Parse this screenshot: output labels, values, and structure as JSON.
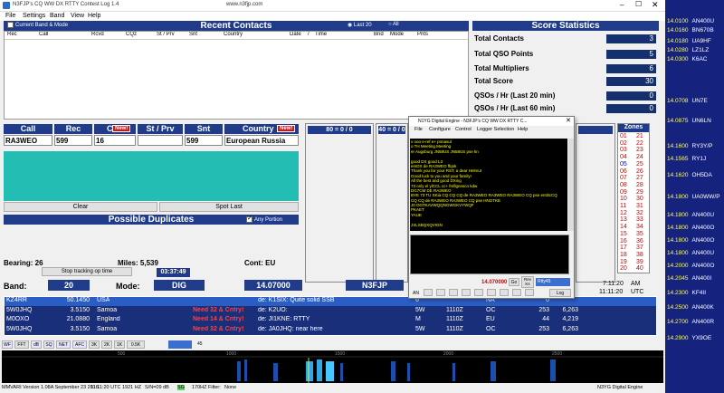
{
  "window": {
    "title": "N3FJP's CQ WW DX RTTY Contest Log 1.4",
    "url": "www.n3fjp.com"
  },
  "menu": [
    "File",
    "Settings",
    "Band",
    "View",
    "Help"
  ],
  "recent": {
    "title": "Recent Contacts",
    "checkbox": "Current Band & Mode",
    "radio1": "Last 20",
    "radio2": "All",
    "headers": [
      "Rec",
      "Call",
      "Rcvd",
      "CQz",
      "St / Prv",
      "Snt",
      "Country",
      "Date",
      "/",
      "Time",
      "Bnd",
      "Mode",
      "Pnts"
    ]
  },
  "score": {
    "title": "Score Statistics",
    "rows": [
      {
        "label": "Total Contacts",
        "value": "3"
      },
      {
        "label": "Total QSO Points",
        "value": "5"
      },
      {
        "label": "Total Multipliers",
        "value": "6"
      },
      {
        "label": "Total Score",
        "value": "30"
      },
      {
        "label": "QSOs / Hr (Last 20 min)",
        "value": "0"
      },
      {
        "label": "QSOs / Hr (Last 60 min)",
        "value": "0"
      }
    ]
  },
  "entry": {
    "call_label": "Call",
    "rec_label": "Rec",
    "cq_label": "C",
    "new_badge": "New!",
    "stprv_label": "St / Prv",
    "snt_label": "Snt",
    "country_label": "Country",
    "call_value": "RA3WEO",
    "rec_value": "599",
    "cq_value": "16",
    "snt_value": "599",
    "country_value": "European Russia"
  },
  "band_boxes": [
    "80 = 0 / 0",
    "40 = 0 / 0"
  ],
  "zones": {
    "title": "Zones",
    "col1": [
      "01",
      "02",
      "03",
      "04",
      "05",
      "06",
      "07",
      "08",
      "09",
      "10",
      "11",
      "12",
      "13",
      "14",
      "15",
      "16",
      "17",
      "18",
      "19",
      "20"
    ],
    "col2": [
      "21",
      "22",
      "23",
      "24",
      "25",
      "26",
      "27",
      "28",
      "29",
      "30",
      "31",
      "32",
      "33",
      "34",
      "35",
      "36",
      "37",
      "38",
      "39",
      "40"
    ]
  },
  "buttons": {
    "clear": "Clear",
    "spot_last": "Spot Last"
  },
  "dupes": {
    "title": "Possible Duplicates",
    "any_portion": "Any Portion"
  },
  "info": {
    "bearing": "Bearing: 26",
    "miles": "Miles: 5,539",
    "cont": "Cont: EU",
    "stop_tracking": "Stop tracking op time",
    "op_time": "03:37:49",
    "band_label": "Band:",
    "band_value": "20",
    "mode_label": "Mode:",
    "mode_value": "DIG",
    "freq": "14.07000",
    "mycall": "N3FJP",
    "time1": "7:11:20",
    "ampm1": "AM",
    "time2": "11:11:20",
    "ampm2": "UTC"
  },
  "spots": [
    {
      "call": "KZ4RR",
      "freq": "50.1450",
      "country": "USA",
      "need": "",
      "msg": "de: K1SIX: Quite solid SSB",
      "band": "6",
      "mode": "",
      "zone": "NA",
      "cq": "0",
      "dist": "",
      "score": "",
      "sel": true
    },
    {
      "call": "5W0JHQ",
      "freq": "3.5150",
      "country": "Samoa",
      "need": "Need 32 & Cntry!",
      "msg": "de: K2UO:",
      "band": "5W",
      "mode": "1110Z",
      "zone": "OC",
      "cq": "253",
      "dist": "6,263",
      "score": "",
      "sel": false
    },
    {
      "call": "M0OXO",
      "freq": "21.0880",
      "country": "England",
      "need": "Need 14 & Cntry!",
      "msg": "de: JI1KNE: RTTY",
      "band": "M",
      "mode": "1110Z",
      "zone": "EU",
      "cq": "44",
      "dist": "4,219",
      "score": "",
      "sel": false
    },
    {
      "call": "5W0JHQ",
      "freq": "3.5150",
      "country": "Samoa",
      "need": "Need 32 & Cntry!",
      "msg": "de: JA0JHQ: near here",
      "band": "5W",
      "mode": "1110Z",
      "zone": "OC",
      "cq": "253",
      "dist": "6,263",
      "score": "",
      "sel": false
    }
  ],
  "digital": {
    "title": "N1YG Digital Engine - N3FJP's CQ WW DX RTTY C...",
    "menu": [
      "File",
      "Configure",
      "Control",
      "Logger Selection",
      "Help"
    ],
    "rx_lines": [
      "v ooo e-ref e+ pnnasul",
      "  o TH Meeting Meeting",
      "er Augsburg JN58US JN58US pse kn",
      "",
      "  good DX good L3",
      "emDX de RA3WEO ffqnk",
      "Thank you for your RST, a dear Helmut",
      "Good luck to you and your family!",
      "All the best and good DXing",
      "73 only el ylCCL cc+ fmflgnnscn kdw",
      "DG7CM DE RA3WEO",
      "BYE 73 TU SKia  CQ CQ CQ de RA3WEO RA3WEO RA3WEO CQ pse errdtcCQ",
      "CQ CQ de RA3WEO RA3WEO CQ pse  HNOTKE",
      "J0 OOTKAVWQQNGWGKVYWQF",
      "PKAET",
      "YAUE",
      "",
      "JXLSBQXQVIGN"
    ],
    "freq": "14.070000",
    "go": "Go",
    "rev": "Rev\nKs",
    "combo": "Rtty45",
    "log": "Log",
    "an": "AN"
  },
  "cluster": [
    {
      "f": "14.0100",
      "c": "AN400U"
    },
    {
      "f": "14.0160",
      "c": "BN670B"
    },
    {
      "f": "14.0180",
      "c": "UA9HF"
    },
    {
      "f": "14.0280",
      "c": "LZ1LZ"
    },
    {
      "f": "14.0300",
      "c": "K6AC"
    },
    {
      "f": "14.0708",
      "c": "UN7E"
    },
    {
      "f": "14.0875",
      "c": "UN6LN"
    },
    {
      "f": "14.1600",
      "c": "RY3Y/P"
    },
    {
      "f": "14.1565",
      "c": "RY1J"
    },
    {
      "f": "14.1620",
      "c": "OH5DA"
    },
    {
      "f": "14.1800",
      "c": "UA0WW/P"
    },
    {
      "f": "14.1800",
      "c": "AN400U"
    },
    {
      "f": "14.1800",
      "c": "AN400O"
    },
    {
      "f": "14.1800",
      "c": "AN400O"
    },
    {
      "f": "14.1800",
      "c": "AN400U"
    },
    {
      "f": "14.2000",
      "c": "AN400O"
    },
    {
      "f": "14.2045",
      "c": "AN400I"
    },
    {
      "f": "14.2300",
      "c": "KF4II"
    },
    {
      "f": "14.2500",
      "c": "AN400K"
    },
    {
      "f": "14.2700",
      "c": "AN400R"
    },
    {
      "f": "14.2900",
      "c": "YX9OE"
    }
  ],
  "waterfall": {
    "toolbar": [
      "WF",
      "FFT",
      "dB",
      "SQ",
      "NET",
      "AFC",
      "3K",
      "2K",
      "1K",
      "0.5K"
    ],
    "scale": [
      "500",
      "1000",
      "1500",
      "2000",
      "2500"
    ],
    "val": "45"
  },
  "status": {
    "items": [
      "MMVARI Version 1.08A  September 23 2016",
      "11:11:20 UTC",
      "1921 HZ",
      "S/N=09 dB",
      "SG",
      "170HZ",
      "Filter:",
      "None",
      "N3YG Digital Engine"
    ]
  }
}
